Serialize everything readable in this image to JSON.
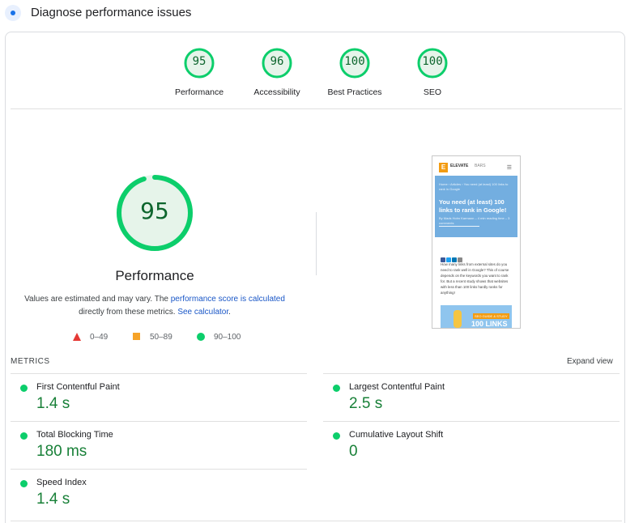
{
  "header": {
    "title": "Diagnose performance issues",
    "icon": "lighthouse-dot-icon"
  },
  "categories": [
    {
      "label": "Performance",
      "score": "95"
    },
    {
      "label": "Accessibility",
      "score": "96"
    },
    {
      "label": "Best Practices",
      "score": "100"
    },
    {
      "label": "SEO",
      "score": "100"
    }
  ],
  "summary": {
    "score": "95",
    "score_value": 95,
    "title": "Performance",
    "note_prefix": "Values are estimated and may vary. The ",
    "note_link1": "performance score is calculated",
    "note_middle": " directly from these metrics. ",
    "note_link2": "See calculator",
    "note_suffix": "."
  },
  "legend": [
    {
      "shape": "triangle",
      "label": "0–49",
      "color": "#e53935"
    },
    {
      "shape": "square",
      "label": "50–89",
      "color": "#f6a328"
    },
    {
      "shape": "circle",
      "label": "90–100",
      "color": "#0cce6b"
    }
  ],
  "screenshot": {
    "brand": "ELEVATE",
    "brand_sub": "BARS",
    "logo_letter": "E",
    "menu_icon": "hamburger-icon",
    "breadcrumb": "Home › Articles › You need (at least) 100 links to rank in Google",
    "headline": "You need (at least) 100 links to rank in Google!",
    "byline": "By Mads Holm Karmann – 4 min reading time – 3 comments",
    "body": "How many links from external sites do you need to rank well in Google? This of course depends on the keywords you want to rank for. But a recent study shows that websites with less than 100 links hardly ranks for anything!",
    "image_tag": "SEO GUIDE & STUDY",
    "image_text": "100 LINKS"
  },
  "metrics": {
    "title": "METRICS",
    "expand_label": "Expand view",
    "items": [
      {
        "name": "First Contentful Paint",
        "value": "1.4 s"
      },
      {
        "name": "Largest Contentful Paint",
        "value": "2.5 s"
      },
      {
        "name": "Total Blocking Time",
        "value": "180 ms"
      },
      {
        "name": "Cumulative Layout Shift",
        "value": "0"
      },
      {
        "name": "Speed Index",
        "value": "1.4 s"
      }
    ]
  },
  "colors": {
    "good": "#0cce6b",
    "good_text": "#188038",
    "link": "#1a57c7"
  }
}
